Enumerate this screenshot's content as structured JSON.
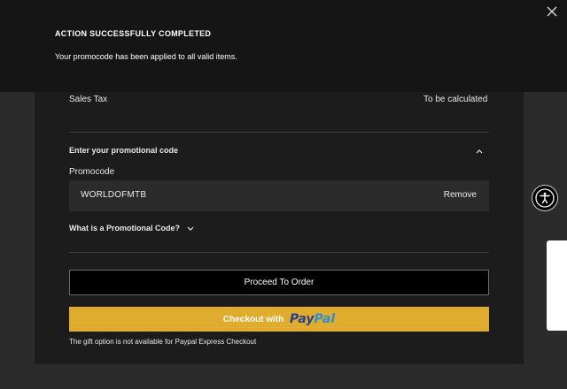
{
  "toast": {
    "title": "ACTION SUCCESSFULLY COMPLETED",
    "message": "Your promocode has been applied to all valid items.",
    "close_icon": "close-icon"
  },
  "summary": {
    "sales_tax_label": "Sales Tax",
    "sales_tax_value": "To be calculated"
  },
  "promo": {
    "header": "Enter your promotional code",
    "header_icon": "chevron-up-icon",
    "field_label": "Promocode",
    "applied_code": "WORLDOFMTB",
    "remove_label": "Remove",
    "help_link": "What is a Promotional Code?",
    "help_icon": "chevron-down-icon"
  },
  "actions": {
    "proceed_label": "Proceed To Order",
    "paypal_label": "Checkout with",
    "paypal_brand_1": "Pay",
    "paypal_brand_2": "Pal",
    "gift_note": "The gift option is not available for Paypal Express Checkout"
  },
  "widgets": {
    "accessibility_icon": "accessibility-icon",
    "side_tab": "feedback-tab"
  },
  "colors": {
    "background": "#2b2b2b",
    "panel": "#1c1c1c",
    "toast": "#151515",
    "paypal_button": "#e0ac2e"
  }
}
